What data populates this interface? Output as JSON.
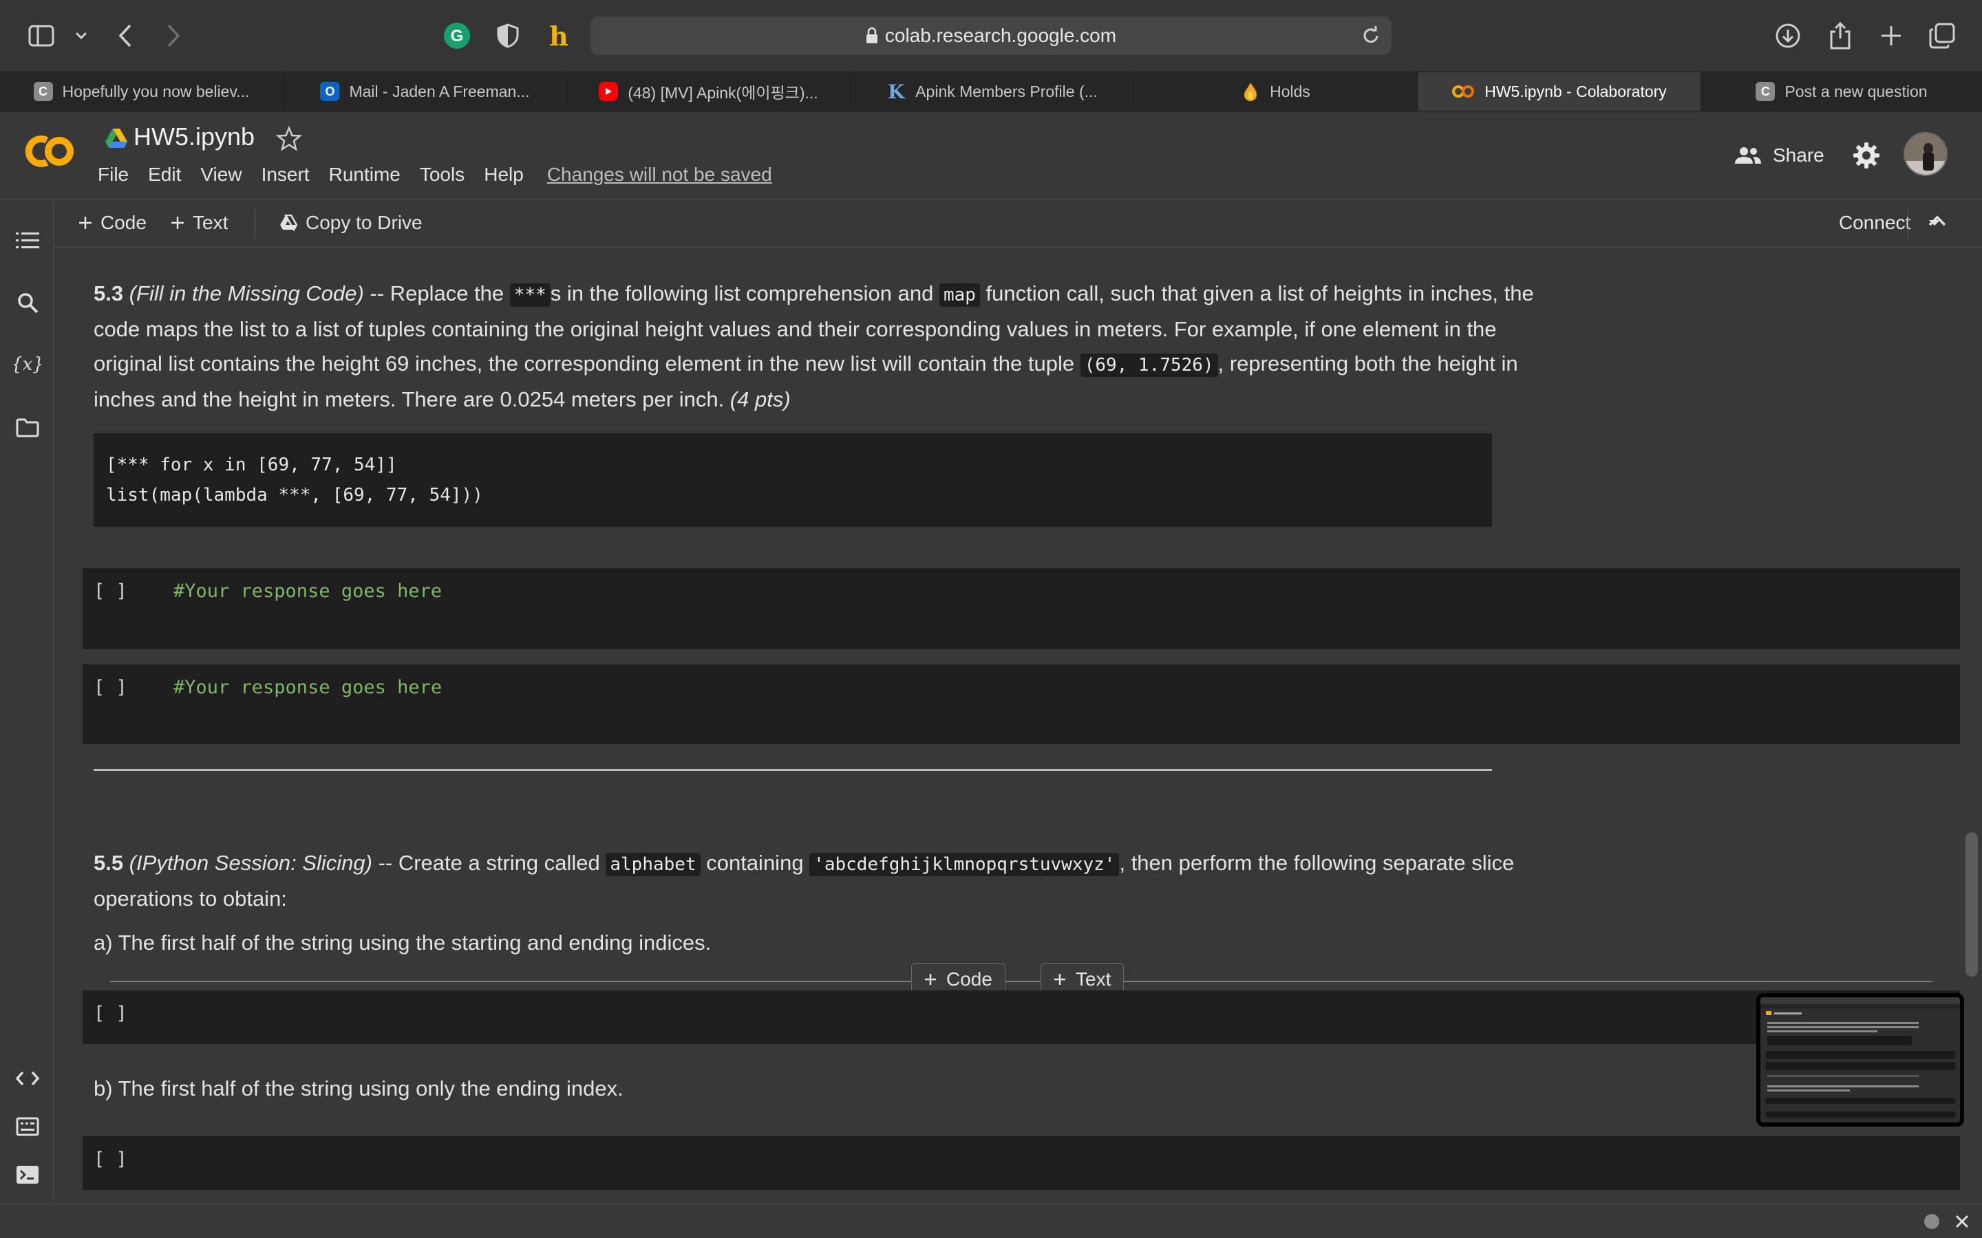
{
  "browser": {
    "url": "colab.research.google.com",
    "tabs": [
      {
        "title": "Hopefully you now believ...",
        "icon": "C"
      },
      {
        "title": "Mail - Jaden A Freeman...",
        "icon": "O"
      },
      {
        "title": "(48) [MV] Apink(에이핑크)...",
        "icon": "youtube-icon"
      },
      {
        "title": "Apink Members Profile (...",
        "icon": "K"
      },
      {
        "title": "Holds",
        "icon": "flame-icon"
      },
      {
        "title": "HW5.ipynb - Colaboratory",
        "icon": "co-logo",
        "active": true
      },
      {
        "title": "Post a new question",
        "icon": "C"
      }
    ]
  },
  "header": {
    "title": "HW5.ipynb",
    "menu": [
      "File",
      "Edit",
      "View",
      "Insert",
      "Runtime",
      "Tools",
      "Help"
    ],
    "unsaved": "Changes will not be saved",
    "share": "Share"
  },
  "toolbar": {
    "add_code": "Code",
    "add_text": "Text",
    "copy_to_drive": "Copy to Drive",
    "connect": "Connect"
  },
  "notebook": {
    "q53": {
      "num": "5.3",
      "topic": "(Fill in the Missing Code)",
      "t1": " -- Replace the ",
      "stars": "***",
      "t2": "s in the following list comprehension and ",
      "map": "map",
      "t3": " function call, such that given a list of heights in inches, the code maps the list to a list of tuples containing the original height values and their corresponding values in meters. For example, if one element in the original list contains the height 69 inches, the corresponding element in the new list will contain the tuple ",
      "tuple": "(69, 1.7526)",
      "t4": ", representing both the height in inches and the height in meters. There are 0.0254 meters per inch. ",
      "pts": "(4 pts)",
      "code_line1": "[*** for x in [69, 77, 54]]",
      "code_line2": "list(map(lambda ***, [69, 77, 54]))"
    },
    "cell_bracket": "[ ]",
    "response_comment": "#Your response goes here",
    "q55": {
      "num": "5.5",
      "topic": "(IPython Session: Slicing)",
      "t1": " -- Create a string called ",
      "var": "alphabet",
      "t2": " containing ",
      "str": "'abcdefghijklmnopqrstuvwxyz'",
      "t3": ", then perform the following separate slice operations to obtain:",
      "a": "a) The first half of the string using the starting and ending indices.",
      "b": "b) The first half of the string using only the ending index."
    },
    "insert_code": "Code",
    "insert_text": "Text"
  }
}
